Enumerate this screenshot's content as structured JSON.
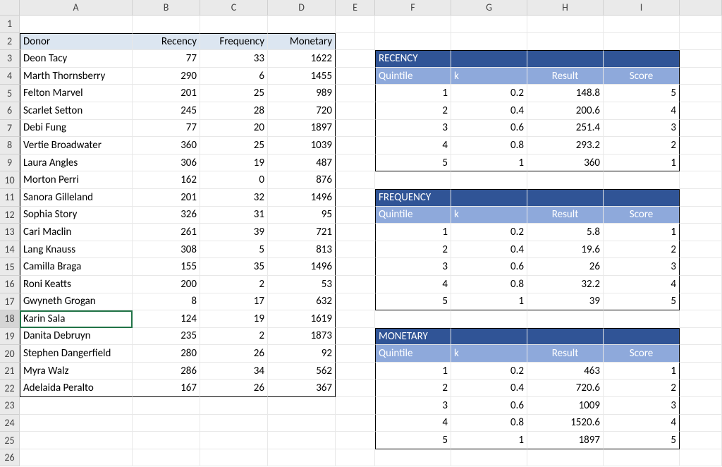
{
  "columns": [
    "A",
    "B",
    "C",
    "D",
    "E",
    "F",
    "G",
    "H",
    "I"
  ],
  "visible_rows": 26,
  "selected_row": 18,
  "donor_table": {
    "headers": {
      "donor": "Donor",
      "recency": "Recency",
      "frequency": "Frequency",
      "monetary": "Monetary"
    },
    "rows": [
      {
        "donor": "Deon Tacy",
        "recency": 77,
        "frequency": 33,
        "monetary": 1622
      },
      {
        "donor": "Marth Thornsberry",
        "recency": 290,
        "frequency": 6,
        "monetary": 1455
      },
      {
        "donor": "Felton Marvel",
        "recency": 201,
        "frequency": 25,
        "monetary": 989
      },
      {
        "donor": "Scarlet Setton",
        "recency": 245,
        "frequency": 28,
        "monetary": 720
      },
      {
        "donor": "Debi Fung",
        "recency": 77,
        "frequency": 20,
        "monetary": 1897
      },
      {
        "donor": "Vertie Broadwater",
        "recency": 360,
        "frequency": 25,
        "monetary": 1039
      },
      {
        "donor": "Laura Angles",
        "recency": 306,
        "frequency": 19,
        "monetary": 487
      },
      {
        "donor": "Morton Perri",
        "recency": 162,
        "frequency": 0,
        "monetary": 876
      },
      {
        "donor": "Sanora Gilleland",
        "recency": 201,
        "frequency": 32,
        "monetary": 1496
      },
      {
        "donor": "Sophia Story",
        "recency": 326,
        "frequency": 31,
        "monetary": 95
      },
      {
        "donor": "Cari Maclin",
        "recency": 261,
        "frequency": 39,
        "monetary": 721
      },
      {
        "donor": "Lang Knauss",
        "recency": 308,
        "frequency": 5,
        "monetary": 813
      },
      {
        "donor": "Camilla Braga",
        "recency": 155,
        "frequency": 35,
        "monetary": 1496
      },
      {
        "donor": "Roni Keatts",
        "recency": 200,
        "frequency": 2,
        "monetary": 53
      },
      {
        "donor": "Gwyneth Grogan",
        "recency": 8,
        "frequency": 17,
        "monetary": 632
      },
      {
        "donor": "Karin Sala",
        "recency": 124,
        "frequency": 19,
        "monetary": 1619
      },
      {
        "donor": "Danita Debruyn",
        "recency": 235,
        "frequency": 2,
        "monetary": 1873
      },
      {
        "donor": "Stephen Dangerfield",
        "recency": 280,
        "frequency": 26,
        "monetary": 92
      },
      {
        "donor": "Myra Walz",
        "recency": 286,
        "frequency": 34,
        "monetary": 562
      },
      {
        "donor": "Adelaida Peralto",
        "recency": 167,
        "frequency": 26,
        "monetary": 367
      }
    ]
  },
  "side_tables": {
    "sub_headers": {
      "quintile": "Quintile",
      "k": "k",
      "result": "Result",
      "score": "Score"
    },
    "recency": {
      "title": "RECENCY",
      "rows": [
        {
          "quintile": 1,
          "k": 0.2,
          "result": 148.8,
          "score": 5
        },
        {
          "quintile": 2,
          "k": 0.4,
          "result": 200.6,
          "score": 4
        },
        {
          "quintile": 3,
          "k": 0.6,
          "result": 251.4,
          "score": 3
        },
        {
          "quintile": 4,
          "k": 0.8,
          "result": 293.2,
          "score": 2
        },
        {
          "quintile": 5,
          "k": 1,
          "result": 360,
          "score": 1
        }
      ]
    },
    "frequency": {
      "title": "FREQUENCY",
      "rows": [
        {
          "quintile": 1,
          "k": 0.2,
          "result": 5.8,
          "score": 1
        },
        {
          "quintile": 2,
          "k": 0.4,
          "result": 19.6,
          "score": 2
        },
        {
          "quintile": 3,
          "k": 0.6,
          "result": 26,
          "score": 3
        },
        {
          "quintile": 4,
          "k": 0.8,
          "result": 32.2,
          "score": 4
        },
        {
          "quintile": 5,
          "k": 1,
          "result": 39,
          "score": 5
        }
      ]
    },
    "monetary": {
      "title": "MONETARY",
      "rows": [
        {
          "quintile": 1,
          "k": 0.2,
          "result": 463,
          "score": 1
        },
        {
          "quintile": 2,
          "k": 0.4,
          "result": 720.6,
          "score": 2
        },
        {
          "quintile": 3,
          "k": 0.6,
          "result": 1009,
          "score": 3
        },
        {
          "quintile": 4,
          "k": 0.8,
          "result": 1520.6,
          "score": 4
        },
        {
          "quintile": 5,
          "k": 1,
          "result": 1897,
          "score": 5
        }
      ]
    }
  }
}
